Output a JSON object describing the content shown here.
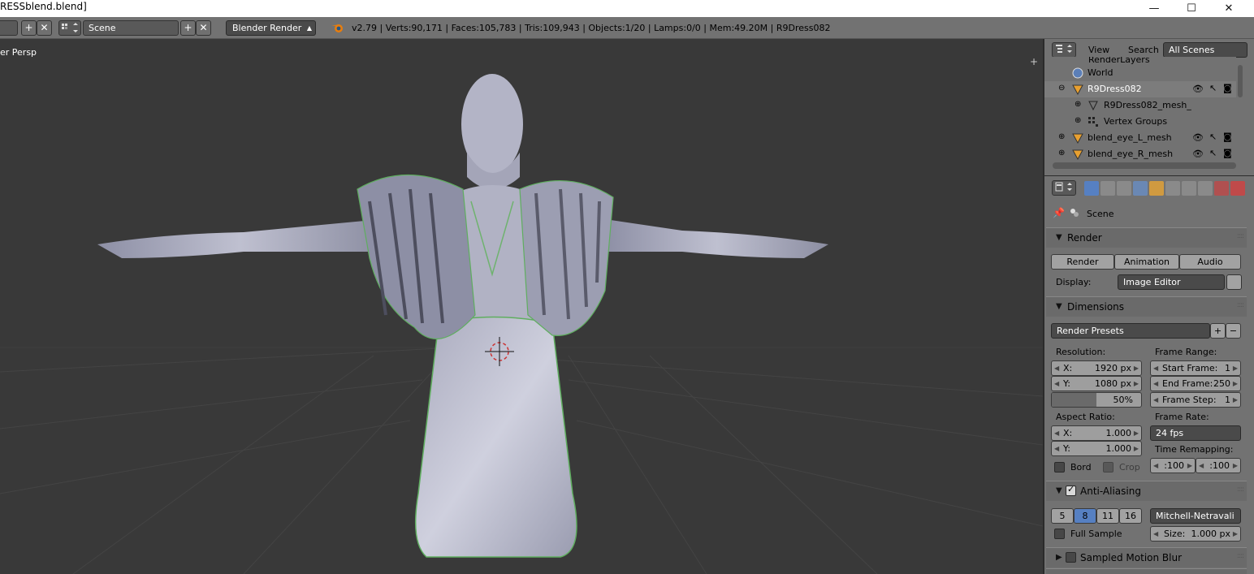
{
  "window": {
    "title": "RESSblend.blend]",
    "minimize": "—",
    "maximize": "☐",
    "close": "✕"
  },
  "infobar": {
    "screen_add": "+",
    "screen_remove": "✕",
    "scene_name": "Scene",
    "scene_add": "+",
    "scene_remove": "✕",
    "render_engine": "Blender Render",
    "stats": "v2.79 | Verts:90,171 | Faces:105,783 | Tris:109,943 | Objects:1/20 | Lamps:0/0 | Mem:49.20M | R9Dress082"
  },
  "viewport": {
    "label": "er Persp"
  },
  "outliner": {
    "menu": [
      "View",
      "Search"
    ],
    "display_mode": "All Scenes",
    "items": [
      {
        "label": "RenderLayers",
        "depth": 1
      },
      {
        "label": "World",
        "depth": 1
      },
      {
        "label": "R9Dress082",
        "depth": 0
      },
      {
        "label": "R9Dress082_mesh_",
        "depth": 1
      },
      {
        "label": "Vertex Groups",
        "depth": 1
      },
      {
        "label": "blend_eye_L_mesh",
        "depth": 0
      },
      {
        "label": "blend_eye_R_mesh",
        "depth": 0
      }
    ]
  },
  "properties": {
    "context": "Scene",
    "render_panel": {
      "title": "Render",
      "render_btn": "Render",
      "animation_btn": "Animation",
      "audio_btn": "Audio",
      "display_label": "Display:",
      "display_value": "Image Editor"
    },
    "dimensions_panel": {
      "title": "Dimensions",
      "presets": "Render Presets",
      "resolution_label": "Resolution:",
      "res_x_label": "X:",
      "res_x": "1920 px",
      "res_y_label": "Y:",
      "res_y": "1080 px",
      "res_pct": "50%",
      "res_pct_value": 0.5,
      "frame_range_label": "Frame Range:",
      "start_label": "Start Frame:",
      "start": "1",
      "end_label": "End Frame:",
      "end": "250",
      "step_label": "Frame Step:",
      "step": "1",
      "aspect_label": "Aspect Ratio:",
      "asp_x_label": "X:",
      "asp_x": "1.000",
      "asp_y_label": "Y:",
      "asp_y": "1.000",
      "frame_rate_label": "Frame Rate:",
      "frame_rate": "24 fps",
      "time_remap_label": "Time Remapping:",
      "remap_old": ":100",
      "remap_new": ":100",
      "bord": "Bord",
      "crop": "Crop"
    },
    "aa_panel": {
      "title": "Anti-Aliasing",
      "samples": [
        "5",
        "8",
        "11",
        "16"
      ],
      "selected_sample": "8",
      "filter": "Mitchell-Netravali",
      "full_sample": "Full Sample",
      "size_label": "Size:",
      "size": "1.000 px"
    },
    "motion_blur_panel": {
      "title": "Sampled Motion Blur"
    }
  }
}
